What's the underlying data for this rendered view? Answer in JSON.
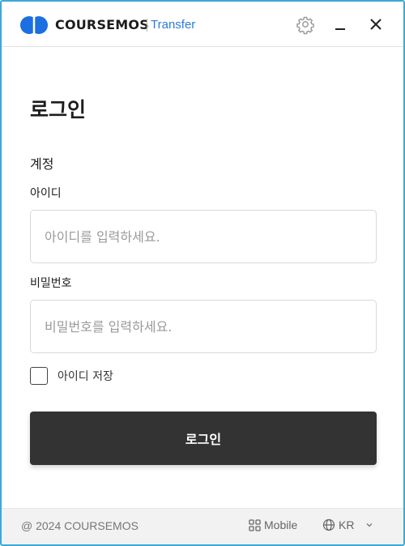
{
  "titlebar": {
    "brand": "COURSEMOS",
    "product": "Transfer"
  },
  "login": {
    "title": "로그인",
    "section_label": "계정",
    "id_label": "아이디",
    "id_placeholder": "아이디를 입력하세요.",
    "password_label": "비밀번호",
    "password_placeholder": "비밀번호를 입력하세요.",
    "remember_label": "아이디 저장",
    "remember_checked": false,
    "submit_label": "로그인"
  },
  "footer": {
    "copyright": "@ 2024 COURSEMOS",
    "mobile_label": "Mobile",
    "language": "KR"
  },
  "colors": {
    "brand_blue": "#1b6fe0",
    "product_blue": "#2b7bd9",
    "button_dark": "#333333",
    "window_border": "#3aa9d8",
    "footer_bg": "#f2f2f2"
  },
  "icons": {
    "logo": "coursemos-logo",
    "settings": "gear-icon",
    "minimize": "minimize-icon",
    "close": "close-icon",
    "mobile": "grid-icon",
    "language": "globe-icon",
    "language_dropdown": "chevron-down-icon"
  }
}
